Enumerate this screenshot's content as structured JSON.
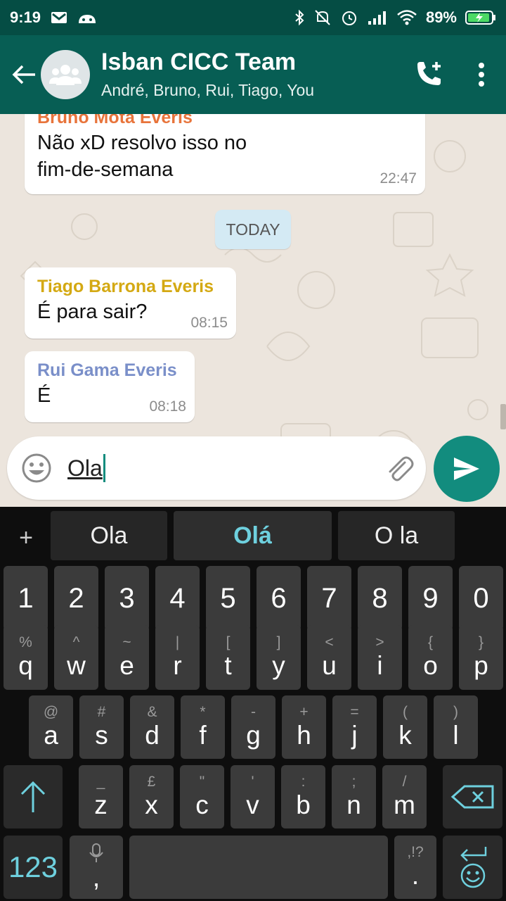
{
  "status": {
    "time": "9:19",
    "battery": "89%"
  },
  "header": {
    "title": "Isban CICC Team",
    "subtitle": "André, Bruno, Rui, Tiago, You"
  },
  "messages": [
    {
      "sender": "Bruno Mota Everis",
      "sender_color": "#e8743b",
      "lines": [
        "Não xD resolvo isso no",
        "fim-de-semana"
      ],
      "time": "22:47"
    },
    {
      "sender": "Tiago Barrona Everis",
      "sender_color": "#d4a913",
      "lines": [
        "É para sair?"
      ],
      "time": "08:15"
    },
    {
      "sender": "Rui Gama Everis",
      "sender_color": "#7a8fc9",
      "lines": [
        "É"
      ],
      "time": "08:18"
    }
  ],
  "date_chip": "TODAY",
  "composer": {
    "text": "Ola"
  },
  "keyboard": {
    "plus": "+",
    "suggestions": [
      "Ola",
      "Olá",
      "O la"
    ],
    "numbers": [
      "1",
      "2",
      "3",
      "4",
      "5",
      "6",
      "7",
      "8",
      "9",
      "0"
    ],
    "row1": [
      {
        "k": "q",
        "s": "%"
      },
      {
        "k": "w",
        "s": "^"
      },
      {
        "k": "e",
        "s": "~"
      },
      {
        "k": "r",
        "s": "|"
      },
      {
        "k": "t",
        "s": "["
      },
      {
        "k": "y",
        "s": "]"
      },
      {
        "k": "u",
        "s": "<"
      },
      {
        "k": "i",
        "s": ">"
      },
      {
        "k": "o",
        "s": "{"
      },
      {
        "k": "p",
        "s": "}"
      }
    ],
    "row2": [
      {
        "k": "a",
        "s": "@"
      },
      {
        "k": "s",
        "s": "#"
      },
      {
        "k": "d",
        "s": "&"
      },
      {
        "k": "f",
        "s": "*"
      },
      {
        "k": "g",
        "s": "-"
      },
      {
        "k": "h",
        "s": "+"
      },
      {
        "k": "j",
        "s": "="
      },
      {
        "k": "k",
        "s": "("
      },
      {
        "k": "l",
        "s": ")"
      }
    ],
    "row3": [
      {
        "k": "z",
        "s": "_"
      },
      {
        "k": "x",
        "s": "£"
      },
      {
        "k": "c",
        "s": "\""
      },
      {
        "k": "v",
        "s": "'"
      },
      {
        "k": "b",
        "s": ":"
      },
      {
        "k": "n",
        "s": ";"
      },
      {
        "k": "m",
        "s": "/"
      }
    ],
    "sym_key": "123",
    "comma_key": ",",
    "period_key": ".",
    "period_sub": ",!?"
  },
  "colors": {
    "header": "#075e54",
    "statusbar": "#054d44",
    "accent": "#128c7e",
    "keyboard_accent": "#6ed0de"
  }
}
